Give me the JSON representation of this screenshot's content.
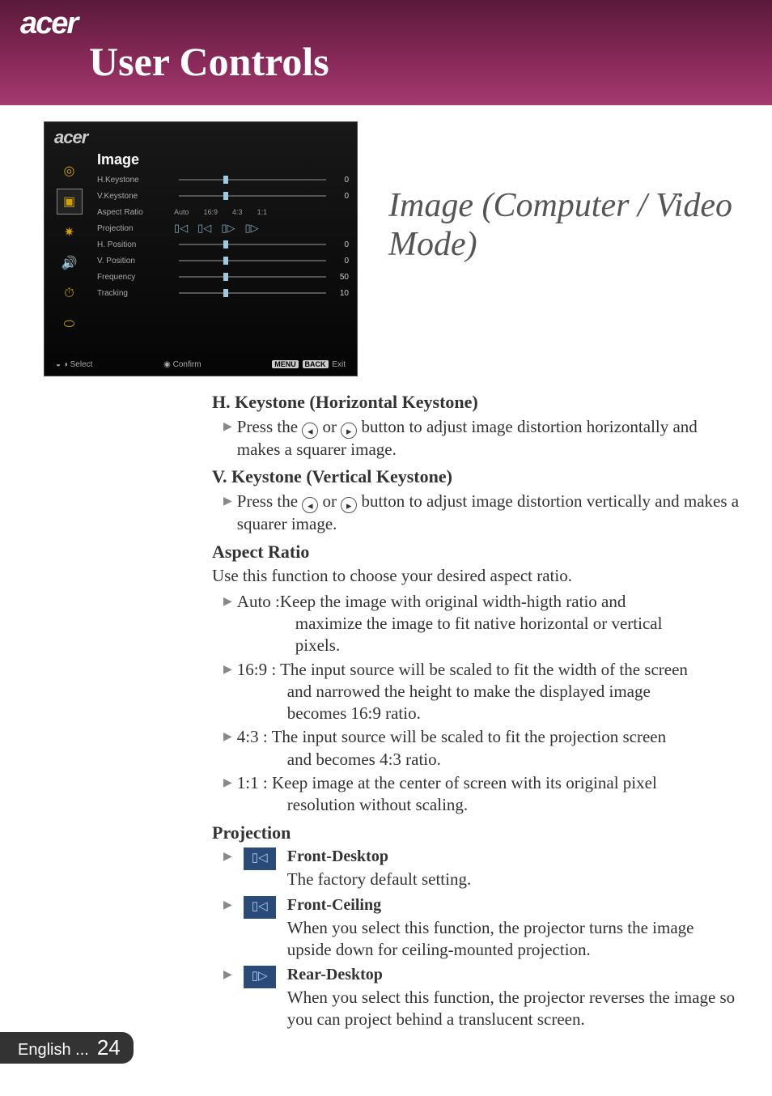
{
  "brand": "acer",
  "page_title": "User Controls",
  "side_title": "Image (Computer / Video Mode)",
  "osd": {
    "brand": "acer",
    "section": "Image",
    "rows": {
      "h_keystone": {
        "label": "H.Keystone",
        "value": "0"
      },
      "v_keystone": {
        "label": "V.Keystone",
        "value": "0"
      },
      "aspect_ratio": {
        "label": "Aspect Ratio",
        "opts": [
          "Auto",
          "16:9",
          "4:3",
          "1:1"
        ]
      },
      "projection": {
        "label": "Projection"
      },
      "h_position": {
        "label": "H. Position",
        "value": "0"
      },
      "v_position": {
        "label": "V. Position",
        "value": "0"
      },
      "frequency": {
        "label": "Frequency",
        "value": "50"
      },
      "tracking": {
        "label": "Tracking",
        "value": "10"
      }
    },
    "footer": {
      "select": "Select",
      "confirm": "Confirm",
      "menu_key": "MENU",
      "back_key": "BACK",
      "exit": "Exit"
    }
  },
  "sections": {
    "h_keystone": {
      "heading": "H. Keystone (Horizontal Keystone)",
      "bullet_pre": "Press the ",
      "bullet_mid": " or ",
      "bullet_post": " button to adjust image distortion horizontally and makes a squarer image."
    },
    "v_keystone": {
      "heading": "V. Keystone (Vertical Keystone)",
      "bullet_pre": "Press the ",
      "bullet_mid": " or ",
      "bullet_post": " button to adjust image distortion vertically and makes a squarer image."
    },
    "aspect_ratio": {
      "heading": "Aspect Ratio",
      "intro": "Use this function to choose your desired aspect ratio.",
      "items": {
        "auto": {
          "lead": "Auto :",
          "l1": "Keep the image with original width-higth ratio and",
          "l2": "maximize the image to fit native horizontal or vertical",
          "l3": "pixels."
        },
        "r169": {
          "lead": "16:9 : ",
          "l1": "The input source will be scaled to fit the width of the screen",
          "l2": "and narrowed the height to make the displayed image",
          "l3": "becomes 16:9 ratio."
        },
        "r43": {
          "lead": "4:3 : ",
          "l1": "The input source will be scaled to fit the projection screen",
          "l2": "and becomes 4:3 ratio."
        },
        "r11": {
          "lead": "1:1 : ",
          "l1": "Keep image at the center of screen with its original pixel",
          "l2": "resolution without scaling."
        }
      }
    },
    "projection": {
      "heading": "Projection",
      "front_desktop": {
        "title": "Front-Desktop",
        "desc": "The factory default setting."
      },
      "front_ceiling": {
        "title": "Front-Ceiling",
        "desc": "When you select this function, the projector turns the image upside down for ceiling-mounted projection."
      },
      "rear_desktop": {
        "title": "Rear-Desktop",
        "desc": "When you select this function, the projector reverses the image so you can project behind a translucent screen."
      }
    }
  },
  "footer": {
    "lang": "English ...",
    "page": "24"
  }
}
